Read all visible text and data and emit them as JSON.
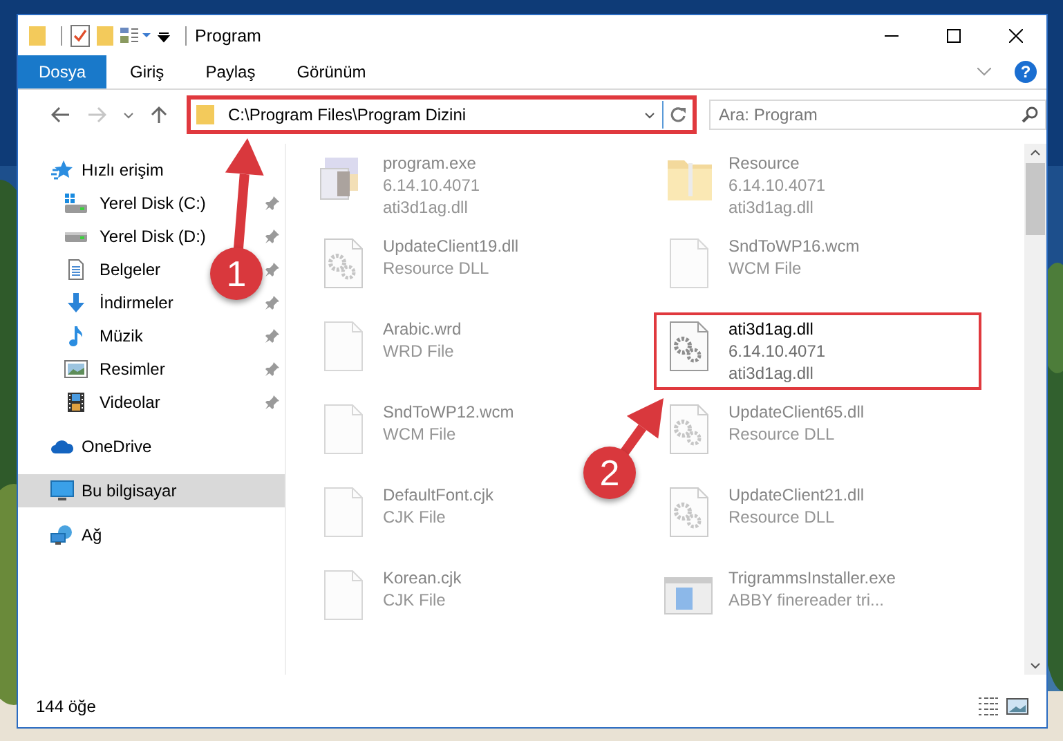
{
  "window": {
    "title": "Program"
  },
  "ribbon": {
    "tabs": [
      {
        "label": "Dosya",
        "kind": "file"
      },
      {
        "label": "Giriş",
        "kind": "tab"
      },
      {
        "label": "Paylaş",
        "kind": "tab"
      },
      {
        "label": "Görünüm",
        "kind": "tab"
      }
    ],
    "help": "?"
  },
  "address_bar": {
    "path": "C:\\Program Files\\Program Dizini",
    "highlighted": true
  },
  "search": {
    "placeholder": "Ara: Program"
  },
  "navigation": [
    {
      "label": "Hızlı erişim",
      "kind": "star",
      "selected": false,
      "children": [
        {
          "label": "Yerel Disk (C:)",
          "kind": "system-drive",
          "pinned": true,
          "selected": false
        },
        {
          "label": "Yerel Disk (D:)",
          "kind": "drive",
          "pinned": true,
          "selected": false
        },
        {
          "label": "Belgeler",
          "kind": "documents",
          "pinned": true,
          "selected": false
        },
        {
          "label": "İndirmeler",
          "kind": "downloads",
          "pinned": true,
          "selected": false
        },
        {
          "label": "Müzik",
          "kind": "music",
          "pinned": true,
          "selected": false
        },
        {
          "label": "Resimler",
          "kind": "pictures",
          "pinned": true,
          "selected": false
        },
        {
          "label": "Videolar",
          "kind": "videos",
          "pinned": true,
          "selected": false
        }
      ]
    },
    {
      "label": "OneDrive",
      "kind": "cloud",
      "selected": false
    },
    {
      "label": "Bu bilgisayar",
      "kind": "computer",
      "selected": true
    },
    {
      "label": "Ağ",
      "kind": "network",
      "selected": false
    }
  ],
  "files": [
    {
      "name": "program.exe",
      "details": [
        "6.14.10.4071",
        "ati3d1ag.dll"
      ],
      "kind": "exe",
      "highlighted": false
    },
    {
      "name": "Resource",
      "details": [
        "6.14.10.4071",
        "ati3d1ag.dll"
      ],
      "kind": "folder",
      "highlighted": false
    },
    {
      "name": "UpdateClient19.dll",
      "details": [
        "Resource DLL"
      ],
      "kind": "dll",
      "highlighted": false
    },
    {
      "name": "SndToWP16.wcm",
      "details": [
        "WCM File"
      ],
      "kind": "blank",
      "highlighted": false
    },
    {
      "name": "Arabic.wrd",
      "details": [
        "WRD File"
      ],
      "kind": "blank",
      "highlighted": false
    },
    {
      "name": "ati3d1ag.dll",
      "details": [
        "6.14.10.4071",
        "ati3d1ag.dll"
      ],
      "kind": "dll",
      "highlighted": true
    },
    {
      "name": "SndToWP12.wcm",
      "details": [
        "WCM File"
      ],
      "kind": "blank",
      "highlighted": false
    },
    {
      "name": "UpdateClient65.dll",
      "details": [
        "Resource DLL"
      ],
      "kind": "dll",
      "highlighted": false
    },
    {
      "name": "DefaultFont.cjk",
      "details": [
        "CJK File"
      ],
      "kind": "blank",
      "highlighted": false
    },
    {
      "name": "UpdateClient21.dll",
      "details": [
        "Resource DLL"
      ],
      "kind": "dll",
      "highlighted": false
    },
    {
      "name": "Korean.cjk",
      "details": [
        "CJK File"
      ],
      "kind": "blank",
      "highlighted": false
    },
    {
      "name": "TrigrammsInstaller.exe",
      "details": [
        "ABBY finereader tri..."
      ],
      "kind": "installer",
      "highlighted": false
    }
  ],
  "status_bar": {
    "count": "144 öğe"
  },
  "annotations": [
    {
      "number": "1"
    },
    {
      "number": "2"
    }
  ]
}
